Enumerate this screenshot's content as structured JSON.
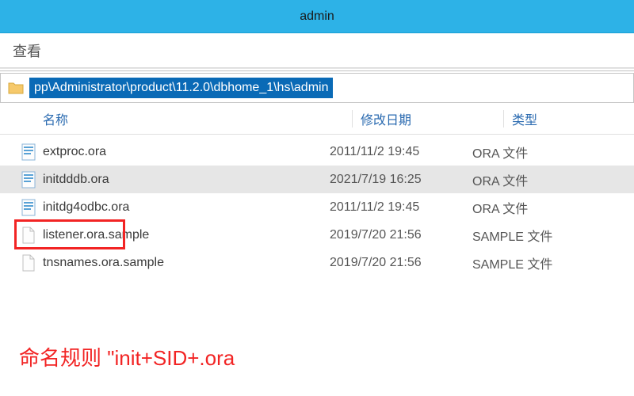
{
  "window": {
    "title": "admin"
  },
  "menubar": {
    "view": "查看"
  },
  "addressbar": {
    "path": "pp\\Administrator\\product\\11.2.0\\dbhome_1\\hs\\admin"
  },
  "columns": {
    "name": "名称",
    "modified": "修改日期",
    "type": "类型"
  },
  "files": [
    {
      "name": "extproc.ora",
      "modified": "2011/11/2 19:45",
      "type": "ORA 文件",
      "icon": "notepad"
    },
    {
      "name": "initdddb.ora",
      "modified": "2021/7/19 16:25",
      "type": "ORA 文件",
      "icon": "notepad",
      "selected": true
    },
    {
      "name": "initdg4odbc.ora",
      "modified": "2011/11/2 19:45",
      "type": "ORA 文件",
      "icon": "notepad"
    },
    {
      "name": "listener.ora.sample",
      "modified": "2019/7/20 21:56",
      "type": "SAMPLE 文件",
      "icon": "blank"
    },
    {
      "name": "tnsnames.ora.sample",
      "modified": "2019/7/20 21:56",
      "type": "SAMPLE 文件",
      "icon": "blank"
    }
  ],
  "annotation": {
    "text": "命名规则 \"init+SID+.ora"
  }
}
